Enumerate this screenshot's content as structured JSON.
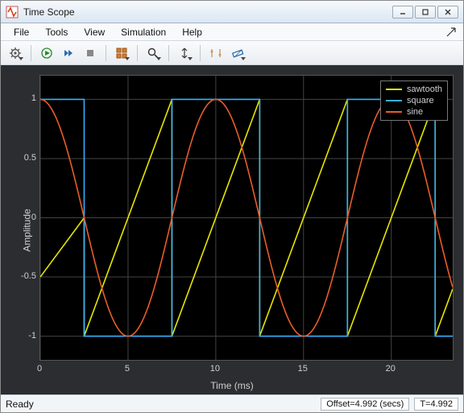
{
  "window": {
    "title": "Time Scope"
  },
  "menu": {
    "items": [
      "File",
      "Tools",
      "View",
      "Simulation",
      "Help"
    ]
  },
  "toolbar": {
    "items": [
      {
        "name": "settings-icon",
        "dd": true
      },
      {
        "name": "run-icon",
        "dd": false
      },
      {
        "name": "step-fwd-icon",
        "dd": false
      },
      {
        "name": "stop-icon",
        "dd": false
      },
      {
        "name": "layout-icon",
        "dd": true
      },
      {
        "name": "zoom-icon",
        "dd": true
      },
      {
        "name": "autoscale-icon",
        "dd": true
      },
      {
        "name": "cursors-icon",
        "dd": false
      },
      {
        "name": "measure-icon",
        "dd": true
      }
    ]
  },
  "status": {
    "ready": "Ready",
    "offset": "Offset=4.992 (secs)",
    "time": "T=4.992"
  },
  "chart_data": {
    "type": "line",
    "xlabel": "Time (ms)",
    "ylabel": "Amplitude",
    "xlim": [
      0,
      23.5
    ],
    "ylim": [
      -1.2,
      1.2
    ],
    "xticks": [
      0,
      5,
      10,
      15,
      20
    ],
    "yticks": [
      -1,
      -0.5,
      0,
      0.5,
      1
    ],
    "series": [
      {
        "name": "sawtooth",
        "color": "#e6e600",
        "x": [
          0,
          2.5,
          2.5,
          7.5,
          7.5,
          12.5,
          12.5,
          17.5,
          17.5,
          22.5,
          22.5,
          23.5
        ],
        "y": [
          -0.5,
          0,
          -1,
          1,
          -1,
          1,
          -1,
          1,
          -1,
          1,
          -1,
          -0.6
        ]
      },
      {
        "name": "square",
        "color": "#33b2ff",
        "x": [
          0,
          2.5,
          2.5,
          7.5,
          7.5,
          12.5,
          12.5,
          17.5,
          17.5,
          22.5,
          22.5,
          23.5
        ],
        "y": [
          1,
          1,
          -1,
          -1,
          1,
          1,
          -1,
          -1,
          1,
          1,
          -1,
          -1
        ]
      },
      {
        "name": "sine",
        "color": "#e85d2a",
        "period": 10.0,
        "phase_x_at_peak": 0,
        "amplitude": 1.0
      }
    ],
    "legend_position": "top-right"
  }
}
